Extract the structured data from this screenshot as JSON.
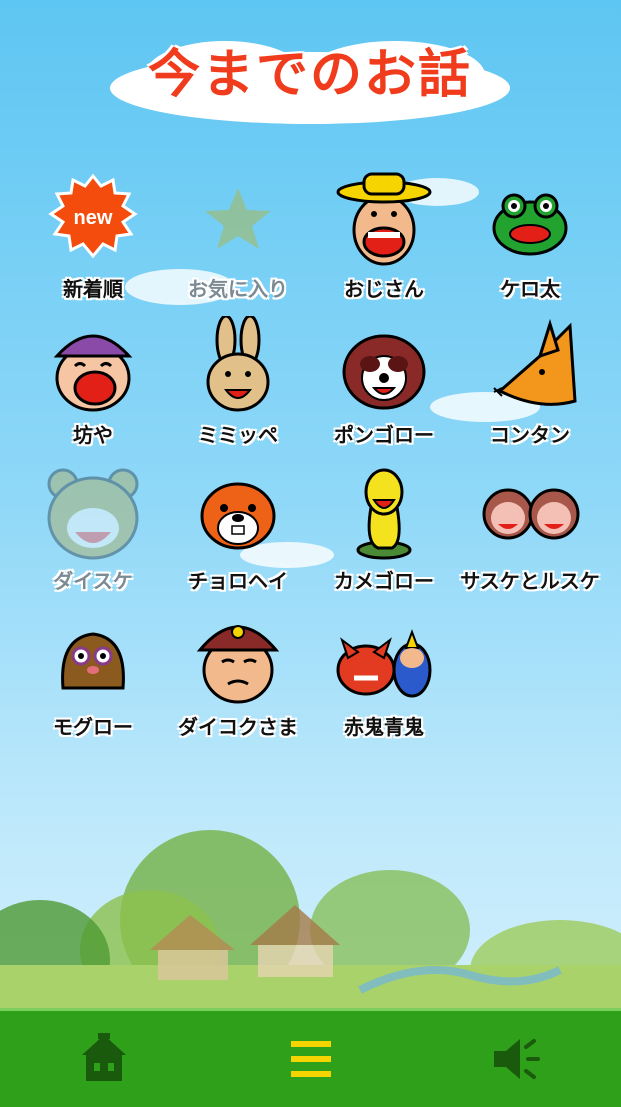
{
  "title": "今までのお話",
  "stories": [
    {
      "label": "新着順",
      "icon": "new-badge-icon",
      "badge": "new"
    },
    {
      "label": "お気に入り",
      "icon": "star-icon",
      "dimmed": true
    },
    {
      "label": "おじさん",
      "icon": "ojisan-face-icon"
    },
    {
      "label": "ケロ太",
      "icon": "frog-face-icon"
    },
    {
      "label": "坊や",
      "icon": "boy-face-icon"
    },
    {
      "label": "ミミッペ",
      "icon": "rabbit-face-icon"
    },
    {
      "label": "ポンゴロー",
      "icon": "raccoon-face-icon"
    },
    {
      "label": "コンタン",
      "icon": "fox-face-icon"
    },
    {
      "label": "ダイスケ",
      "icon": "bear-face-icon",
      "dimmed": true
    },
    {
      "label": "チョロヘイ",
      "icon": "squirrel-face-icon"
    },
    {
      "label": "カメゴロー",
      "icon": "turtle-face-icon"
    },
    {
      "label": "サスケとルスケ",
      "icon": "monkeys-face-icon"
    },
    {
      "label": "モグロー",
      "icon": "mole-face-icon"
    },
    {
      "label": "ダイコクさま",
      "icon": "daikoku-face-icon"
    },
    {
      "label": "赤鬼青鬼",
      "icon": "oni-faces-icon"
    }
  ],
  "bottom_bar": {
    "home": "home-icon",
    "menu": "menu-icon",
    "sound": "speaker-icon"
  },
  "colors": {
    "title": "#f03c1c",
    "bar": "#2ea01a",
    "accent": "#f5d400"
  }
}
